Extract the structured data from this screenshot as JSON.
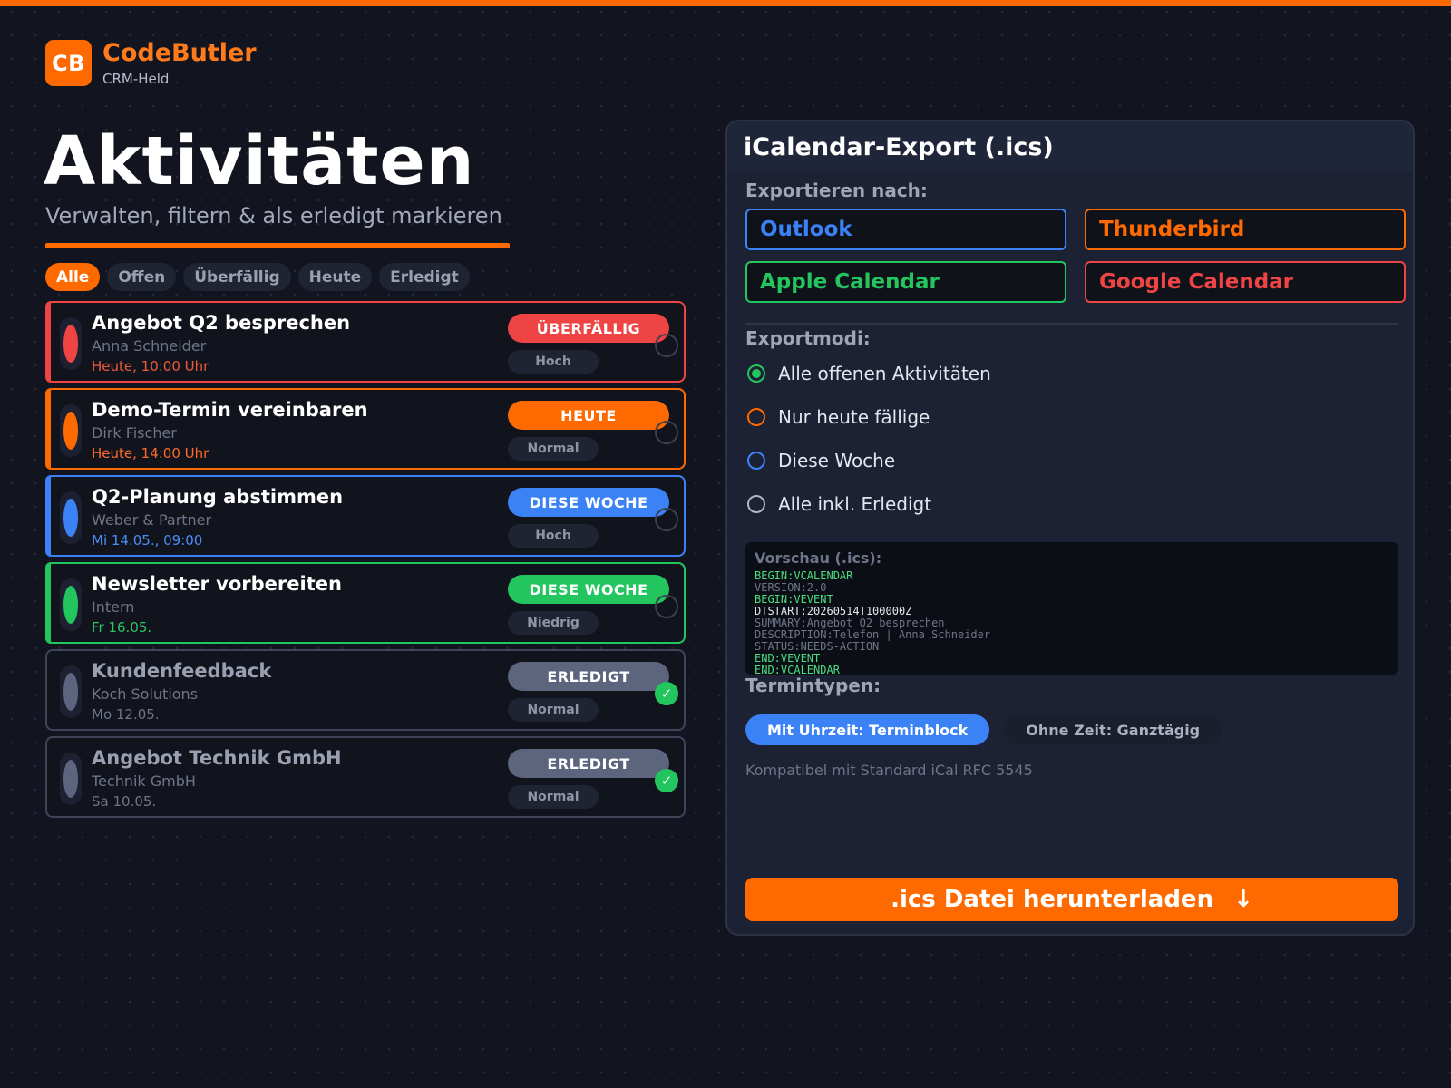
{
  "brand": {
    "logo": "CB",
    "name": "CodeButler",
    "subtitle": "CRM-Held"
  },
  "page": {
    "title": "Aktivitäten",
    "subtitle": "Verwalten, filtern & als erledigt markieren"
  },
  "filters": [
    {
      "label": "Alle",
      "active": true
    },
    {
      "label": "Offen",
      "active": false
    },
    {
      "label": "Überfällig",
      "active": false
    },
    {
      "label": "Heute",
      "active": false
    },
    {
      "label": "Erledigt",
      "active": false
    }
  ],
  "activities": [
    {
      "title": "Angebot Q2 besprechen",
      "contact": "Anna Schneider",
      "due": "Heute, 10:00 Uhr",
      "status": "ÜBERFÄLLIG",
      "priority": "Hoch",
      "color": "#ef4444",
      "due_color": "#ef5a3a",
      "done": false
    },
    {
      "title": "Demo-Termin vereinbaren",
      "contact": "Dirk Fischer",
      "due": "Heute, 14:00 Uhr",
      "status": "HEUTE",
      "priority": "Normal",
      "color": "#ff6a00",
      "due_color": "#ff6a2a",
      "done": false
    },
    {
      "title": "Q2-Planung abstimmen",
      "contact": "Weber & Partner",
      "due": "Mi 14.05., 09:00",
      "status": "DIESE WOCHE",
      "priority": "Hoch",
      "color": "#3b82f6",
      "due_color": "#4a8ef5",
      "done": false
    },
    {
      "title": "Newsletter vorbereiten",
      "contact": "Intern",
      "due": "Fr 16.05.",
      "status": "DIESE WOCHE",
      "priority": "Niedrig",
      "color": "#22c55e",
      "due_color": "#2fc463",
      "done": false
    },
    {
      "title": "Kundenfeedback",
      "contact": "Koch Solutions",
      "due": "Mo 12.05.",
      "status": "ERLEDIGT",
      "priority": "Normal",
      "color": "#5d647d",
      "due_color": "#6e7588",
      "done": true
    },
    {
      "title": "Angebot Technik GmbH",
      "contact": "Technik GmbH",
      "due": "Sa 10.05.",
      "status": "ERLEDIGT",
      "priority": "Normal",
      "color": "#5d647d",
      "due_color": "#6e7588",
      "done": true
    }
  ],
  "export": {
    "title": "iCalendar-Export (.ics)",
    "targets_label": "Exportieren nach:",
    "targets": [
      {
        "label": "Outlook",
        "color": "#3b82f6"
      },
      {
        "label": "Thunderbird",
        "color": "#ff6a00"
      },
      {
        "label": "Apple Calendar",
        "color": "#22c55e"
      },
      {
        "label": "Google Calendar",
        "color": "#ef4444"
      }
    ],
    "modes_label": "Exportmodi:",
    "modes": [
      {
        "label": "Alle offenen Aktivitäten",
        "color": "#22c55e",
        "selected": true
      },
      {
        "label": "Nur heute fällige",
        "color": "#ff6a00",
        "selected": false
      },
      {
        "label": "Diese Woche",
        "color": "#3b82f6",
        "selected": false
      },
      {
        "label": "Alle inkl. Erledigt",
        "color": "#b0b5c2",
        "selected": false
      }
    ],
    "preview_label": "Vorschau (.ics):",
    "preview_lines": [
      {
        "text": "BEGIN:VCALENDAR",
        "color": "#4ade80"
      },
      {
        "text": "VERSION:2.0",
        "color": "#6e7588"
      },
      {
        "text": "BEGIN:VEVENT",
        "color": "#4ade80"
      },
      {
        "text": "DTSTART:20260514T100000Z",
        "color": "#e3e6ee"
      },
      {
        "text": "SUMMARY:Angebot Q2 besprechen",
        "color": "#6e7588"
      },
      {
        "text": "DESCRIPTION:Telefon | Anna Schneider",
        "color": "#6e7588"
      },
      {
        "text": "STATUS:NEEDS-ACTION",
        "color": "#6e7588"
      },
      {
        "text": "END:VEVENT",
        "color": "#4ade80"
      },
      {
        "text": "END:VCALENDAR",
        "color": "#4ade80"
      }
    ],
    "types_label": "Termintypen:",
    "types": [
      {
        "label": "Mit Uhrzeit: Terminblock",
        "active": true
      },
      {
        "label": "Ohne Zeit: Ganztägig",
        "active": false
      }
    ],
    "compat": "Kompatibel mit Standard iCal RFC 5545",
    "download_label": ".ics Datei herunterladen",
    "download_icon": "↓"
  }
}
